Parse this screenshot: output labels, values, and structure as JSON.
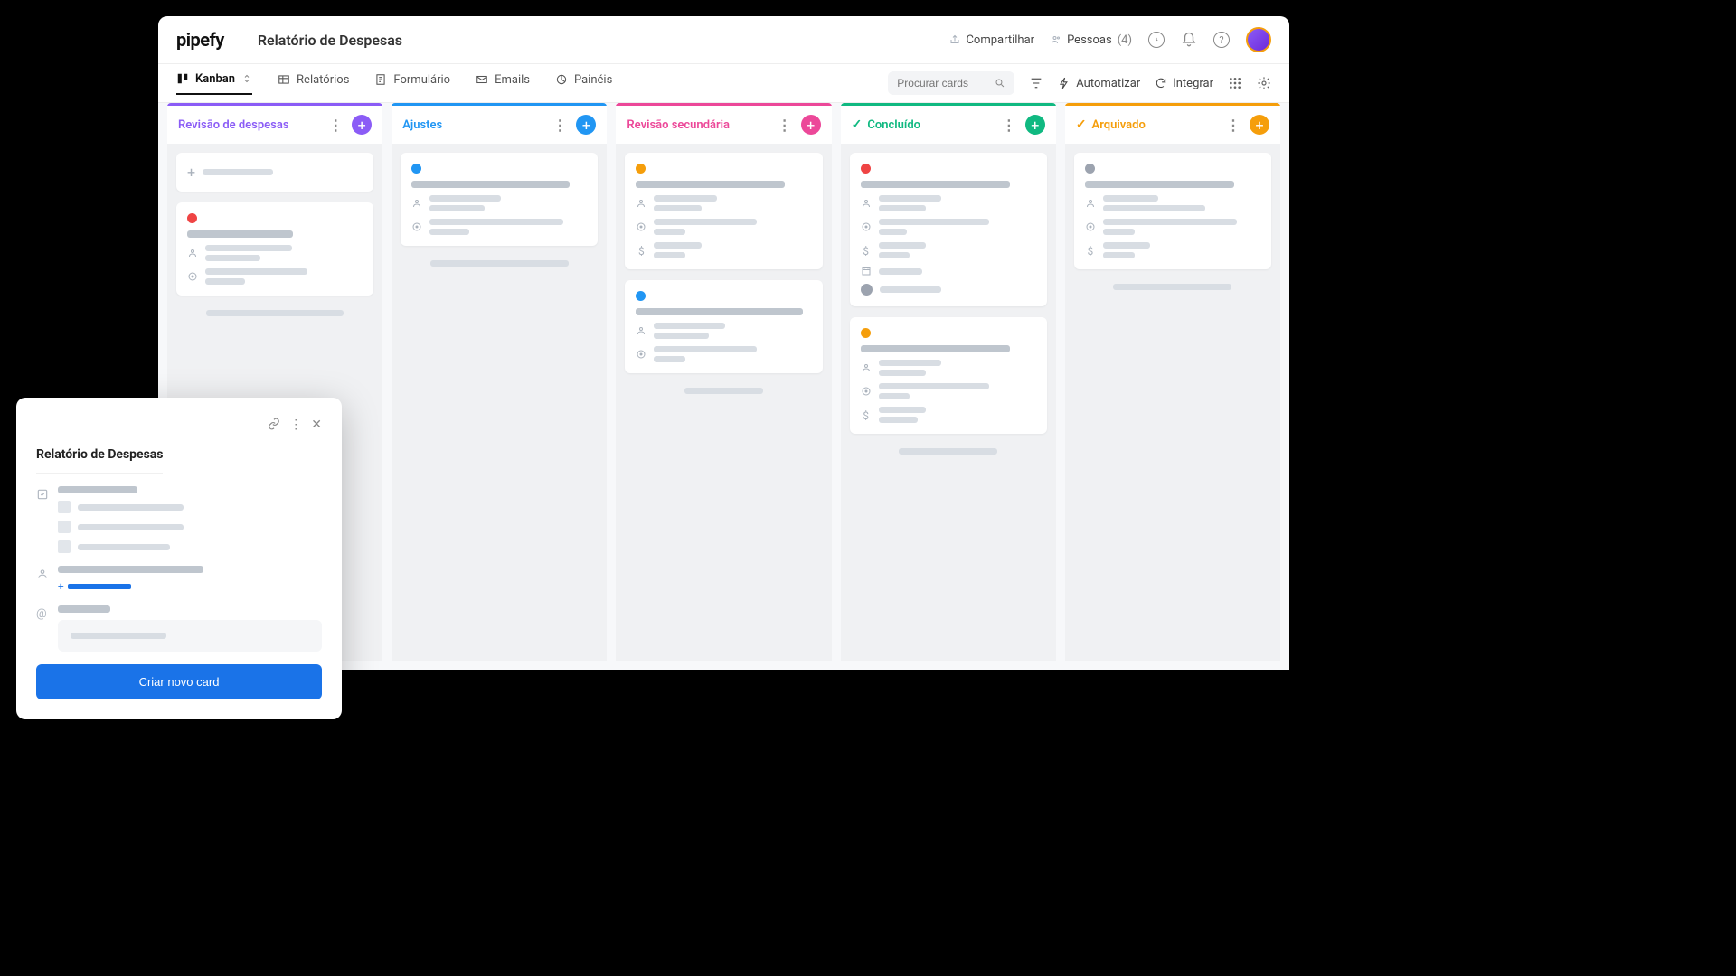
{
  "header": {
    "logo": "pipefy",
    "title": "Relatório de Despesas",
    "share": "Compartilhar",
    "people": "Pessoas",
    "people_count": "(4)"
  },
  "toolbar": {
    "tabs": {
      "kanban": "Kanban",
      "reports": "Relatórios",
      "form": "Formulário",
      "emails": "Emails",
      "panels": "Painéis"
    },
    "search_placeholder": "Procurar cards",
    "automate": "Automatizar",
    "integrate": "Integrar"
  },
  "columns": [
    {
      "title": "Revisão de despesas",
      "color": "#8b5cf6",
      "addColor": "#8b5cf6",
      "hasCheck": false,
      "titleColor": "#8b5cf6"
    },
    {
      "title": "Ajustes",
      "color": "#2196f3",
      "addColor": "#2196f3",
      "hasCheck": false,
      "titleColor": "#2196f3"
    },
    {
      "title": "Revisão secundária",
      "color": "#ec4899",
      "addColor": "#ec4899",
      "hasCheck": false,
      "titleColor": "#ec4899"
    },
    {
      "title": "Concluído",
      "color": "#10b981",
      "addColor": "#10b981",
      "hasCheck": true,
      "titleColor": "#10b981"
    },
    {
      "title": "Arquivado",
      "color": "#f59e0b",
      "addColor": "#f59e0b",
      "hasCheck": true,
      "titleColor": "#f59e0b"
    }
  ],
  "modal": {
    "title": "Relatório de Despesas",
    "create_btn": "Criar novo card"
  },
  "dots": {
    "red": "#ef4444",
    "blue": "#2196f3",
    "orange": "#f59e0b",
    "gray": "#9ca3af"
  }
}
